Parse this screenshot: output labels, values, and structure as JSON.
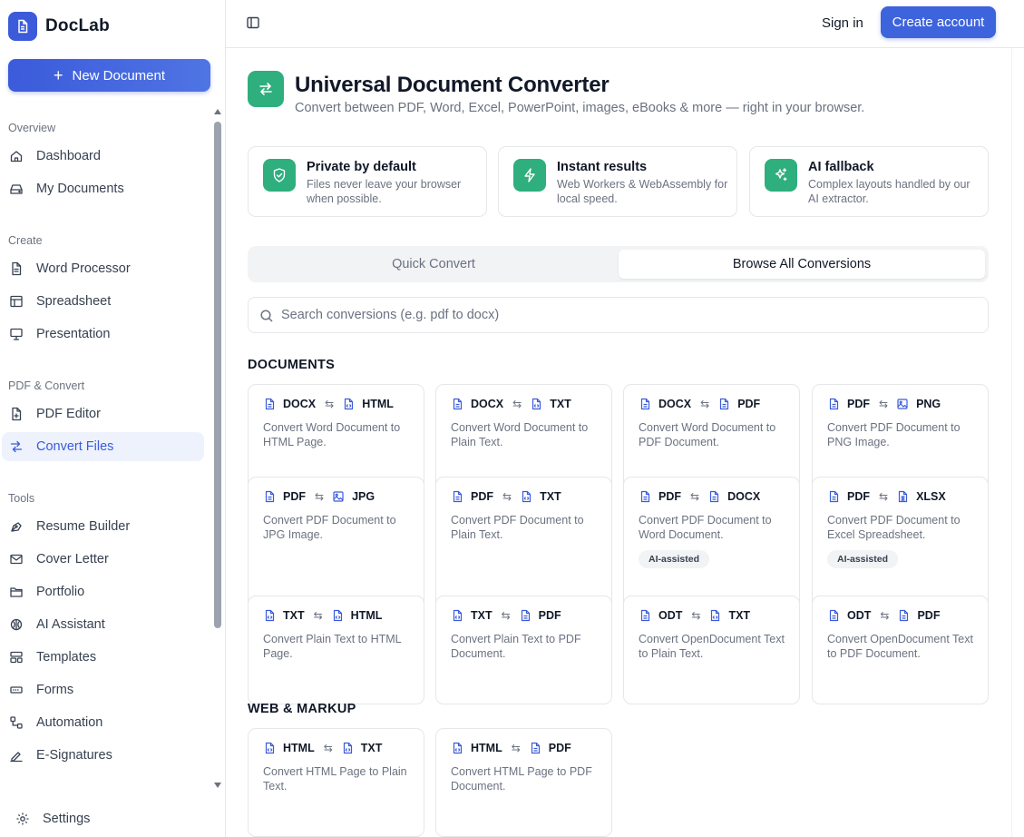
{
  "app": {
    "name": "DocLab",
    "new_document": "New Document"
  },
  "sidebar": {
    "sections": [
      {
        "label": "Overview",
        "items": [
          {
            "label": "Dashboard",
            "icon": "home-icon"
          },
          {
            "label": "My Documents",
            "icon": "drive-icon"
          }
        ]
      },
      {
        "label": "Create",
        "items": [
          {
            "label": "Word Processor",
            "icon": "document-icon"
          },
          {
            "label": "Spreadsheet",
            "icon": "table-icon"
          },
          {
            "label": "Presentation",
            "icon": "presentation-icon"
          }
        ]
      },
      {
        "label": "PDF & Convert",
        "items": [
          {
            "label": "PDF Editor",
            "icon": "pdf-edit-icon"
          },
          {
            "label": "Convert Files",
            "icon": "convert-icon",
            "active": true
          }
        ]
      },
      {
        "label": "Tools",
        "items": [
          {
            "label": "Resume Builder",
            "icon": "pen-tool-icon"
          },
          {
            "label": "Cover Letter",
            "icon": "mail-icon"
          },
          {
            "label": "Portfolio",
            "icon": "folder-icon"
          },
          {
            "label": "AI Assistant",
            "icon": "brain-icon"
          },
          {
            "label": "Templates",
            "icon": "layout-icon"
          },
          {
            "label": "Forms",
            "icon": "form-icon"
          },
          {
            "label": "Automation",
            "icon": "workflow-icon"
          },
          {
            "label": "E-Signatures",
            "icon": "signature-icon"
          }
        ]
      }
    ],
    "settings": "Settings"
  },
  "topbar": {
    "sign_in": "Sign in",
    "create_account": "Create account"
  },
  "page": {
    "title": "Universal Document Converter",
    "subtitle": "Convert between PDF, Word, Excel, PowerPoint, images, eBooks & more — right in your browser."
  },
  "features": [
    {
      "title": "Private by default",
      "desc": "Files never leave your browser when possible.",
      "icon": "shield-icon"
    },
    {
      "title": "Instant results",
      "desc": "Web Workers & WebAssembly for local speed.",
      "icon": "lightning-icon"
    },
    {
      "title": "AI fallback",
      "desc": "Complex layouts handled by our AI extractor.",
      "icon": "sparkles-icon"
    }
  ],
  "tabs": {
    "quick": "Quick Convert",
    "browse": "Browse All Conversions"
  },
  "search": {
    "placeholder": "Search conversions (e.g. pdf to docx)",
    "value": ""
  },
  "categories": [
    {
      "heading": "DOCUMENTS",
      "conversions": [
        {
          "from": "DOCX",
          "to": "HTML",
          "from_icon": "doc",
          "to_icon": "code",
          "desc": "Convert Word Document to HTML Page."
        },
        {
          "from": "DOCX",
          "to": "TXT",
          "from_icon": "doc",
          "to_icon": "code",
          "desc": "Convert Word Document to Plain Text."
        },
        {
          "from": "DOCX",
          "to": "PDF",
          "from_icon": "doc",
          "to_icon": "doc",
          "desc": "Convert Word Document to PDF Document."
        },
        {
          "from": "PDF",
          "to": "PNG",
          "from_icon": "doc",
          "to_icon": "image",
          "desc": "Convert PDF Document to PNG Image."
        },
        {
          "from": "PDF",
          "to": "JPG",
          "from_icon": "doc",
          "to_icon": "image",
          "desc": "Convert PDF Document to JPG Image."
        },
        {
          "from": "PDF",
          "to": "TXT",
          "from_icon": "doc",
          "to_icon": "code",
          "desc": "Convert PDF Document to Plain Text."
        },
        {
          "from": "PDF",
          "to": "DOCX",
          "from_icon": "doc",
          "to_icon": "doc",
          "desc": "Convert PDF Document to Word Document.",
          "badge": "AI-assisted"
        },
        {
          "from": "PDF",
          "to": "XLSX",
          "from_icon": "doc",
          "to_icon": "sheet",
          "desc": "Convert PDF Document to Excel Spreadsheet.",
          "badge": "AI-assisted"
        },
        {
          "from": "TXT",
          "to": "HTML",
          "from_icon": "code",
          "to_icon": "code",
          "desc": "Convert Plain Text to HTML Page."
        },
        {
          "from": "TXT",
          "to": "PDF",
          "from_icon": "code",
          "to_icon": "doc",
          "desc": "Convert Plain Text to PDF Document."
        },
        {
          "from": "ODT",
          "to": "TXT",
          "from_icon": "doc",
          "to_icon": "code",
          "desc": "Convert OpenDocument Text to Plain Text."
        },
        {
          "from": "ODT",
          "to": "PDF",
          "from_icon": "doc",
          "to_icon": "doc",
          "desc": "Convert OpenDocument Text to PDF Document."
        }
      ]
    },
    {
      "heading": "WEB & MARKUP",
      "conversions": [
        {
          "from": "HTML",
          "to": "TXT",
          "from_icon": "code",
          "to_icon": "code",
          "desc": "Convert HTML Page to Plain Text."
        },
        {
          "from": "HTML",
          "to": "PDF",
          "from_icon": "code",
          "to_icon": "doc",
          "desc": "Convert HTML Page to PDF Document."
        }
      ]
    }
  ],
  "colors": {
    "primary": "#3b5bdb",
    "accent_green": "#2fae7e",
    "active_bg": "#eef2fc"
  }
}
